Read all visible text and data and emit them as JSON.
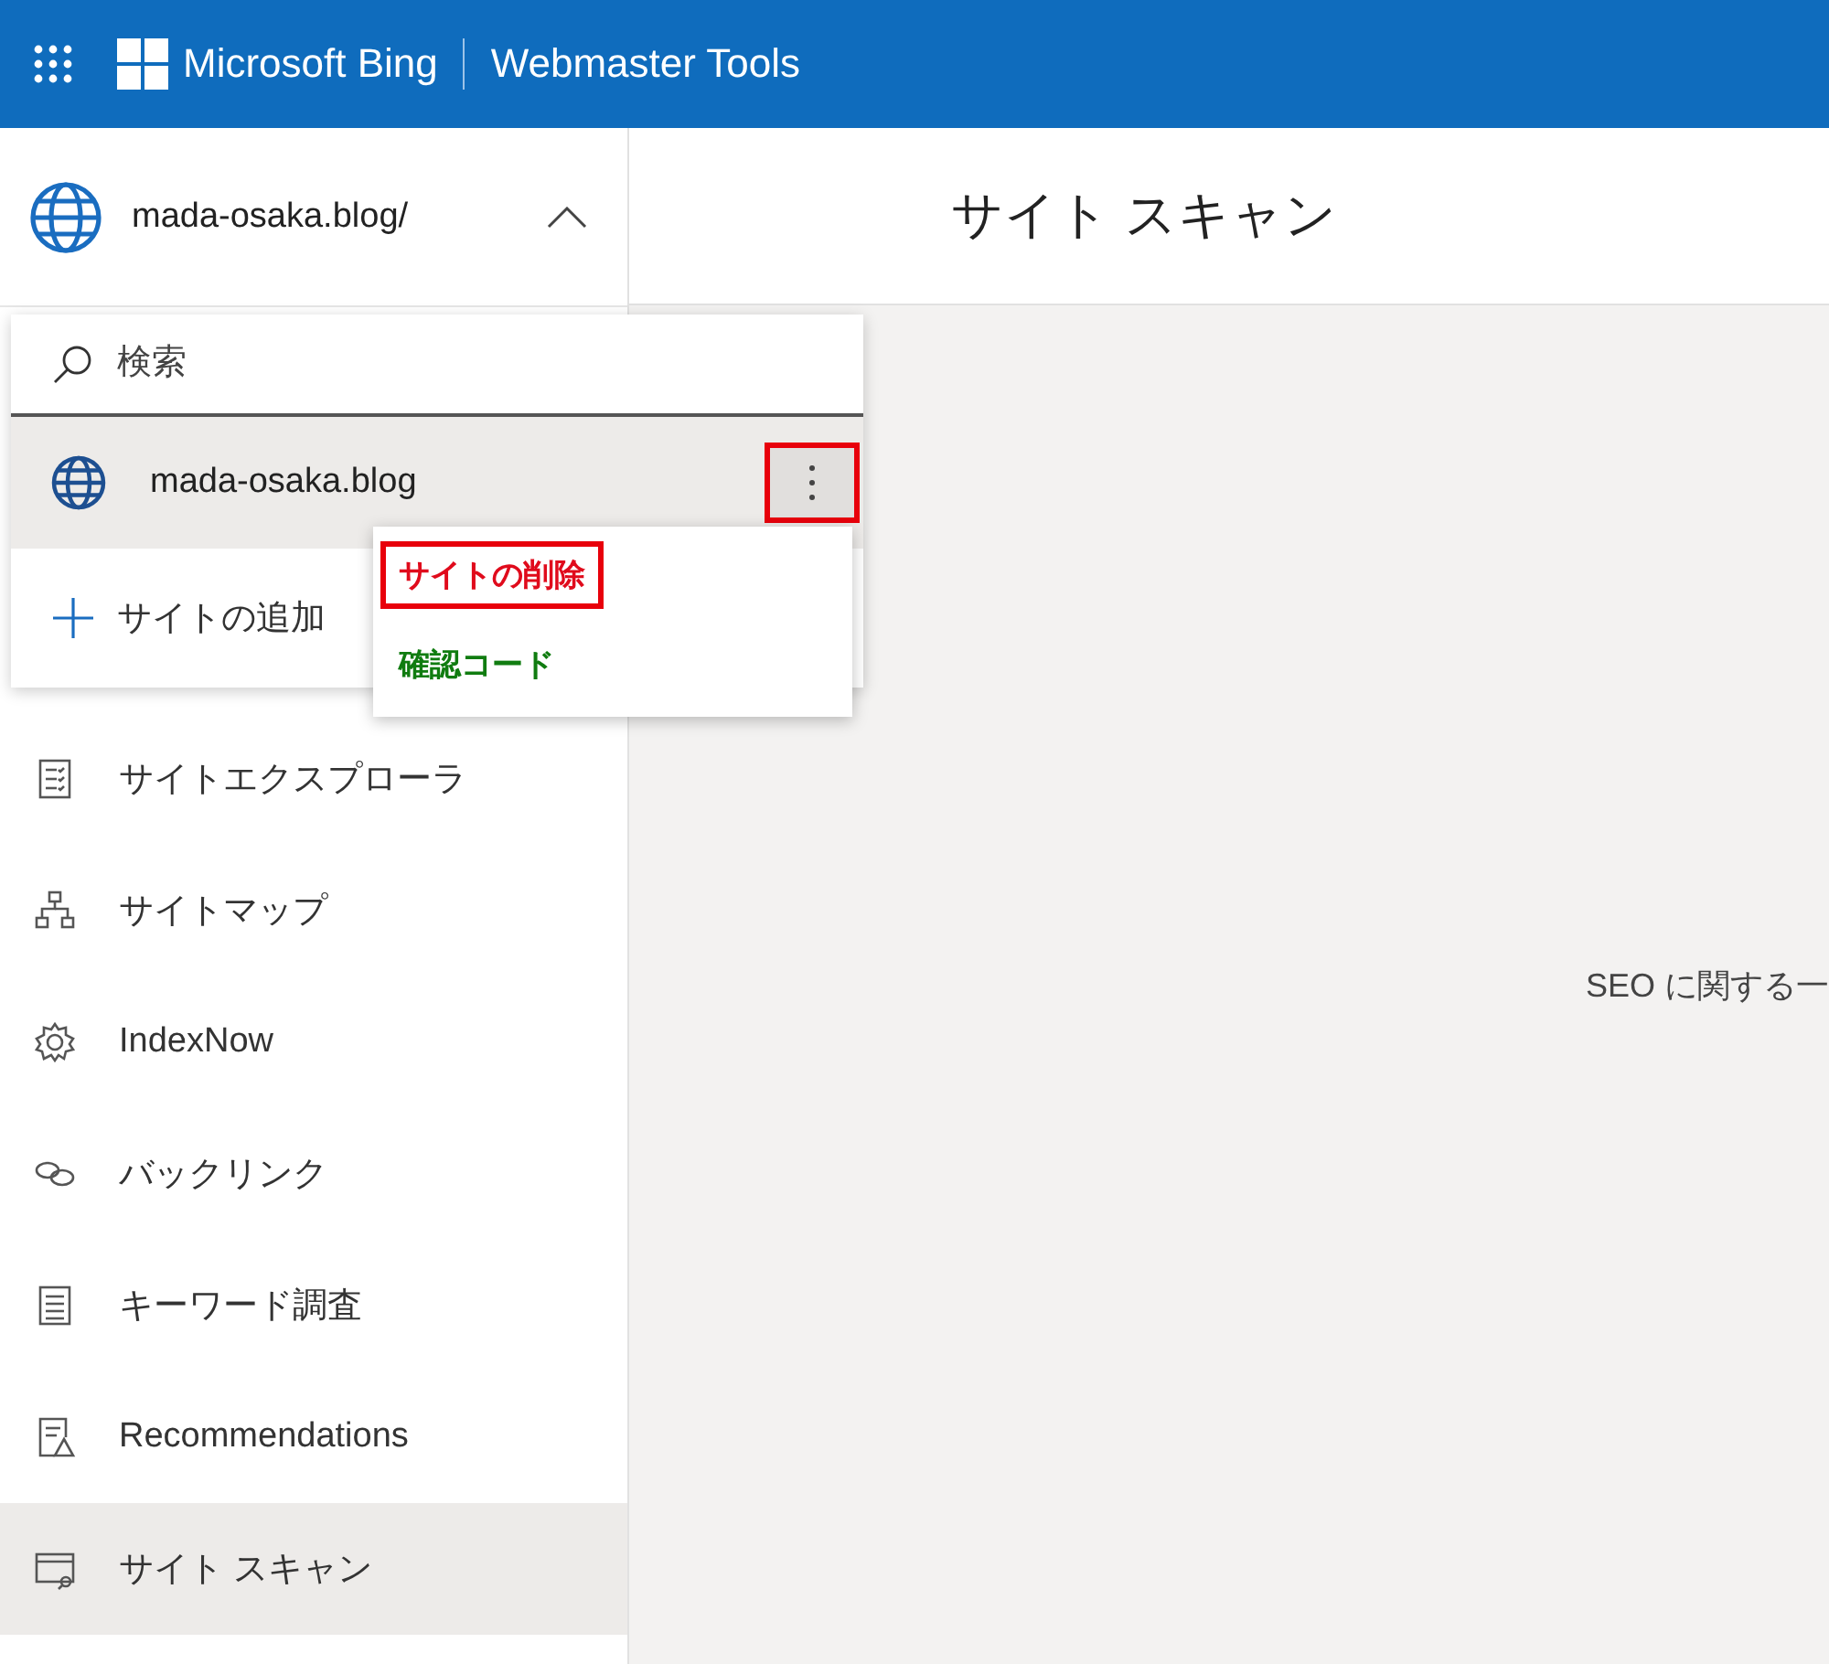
{
  "header": {
    "brand": "Microsoft Bing",
    "product": "Webmaster Tools"
  },
  "site_selector": {
    "site": "mada-osaka.blog/",
    "expanded": true
  },
  "site_dropdown": {
    "search": {
      "placeholder": "検索"
    },
    "sites": [
      {
        "name": "mada-osaka.blog",
        "selected": true,
        "menu_open": true,
        "highlighted": true
      }
    ],
    "add_site": "サイトの追加"
  },
  "context_menu": [
    {
      "label": "サイトの削除",
      "color": "#e00b1c",
      "highlighted": true
    },
    {
      "label": "確認コード",
      "color": "#107c10",
      "highlighted": false
    }
  ],
  "nav": [
    {
      "label": "サイトエクスプローラ",
      "selected": false
    },
    {
      "label": "サイトマップ",
      "selected": false
    },
    {
      "label": "IndexNow",
      "selected": false
    },
    {
      "label": "バックリンク",
      "selected": false
    },
    {
      "label": "キーワード調査",
      "selected": false
    },
    {
      "label": "Recommendations",
      "selected": false
    },
    {
      "label": "サイト スキャン",
      "selected": true
    }
  ],
  "page": {
    "title": "サイト スキャン",
    "body_text": "SEO に関する一"
  }
}
